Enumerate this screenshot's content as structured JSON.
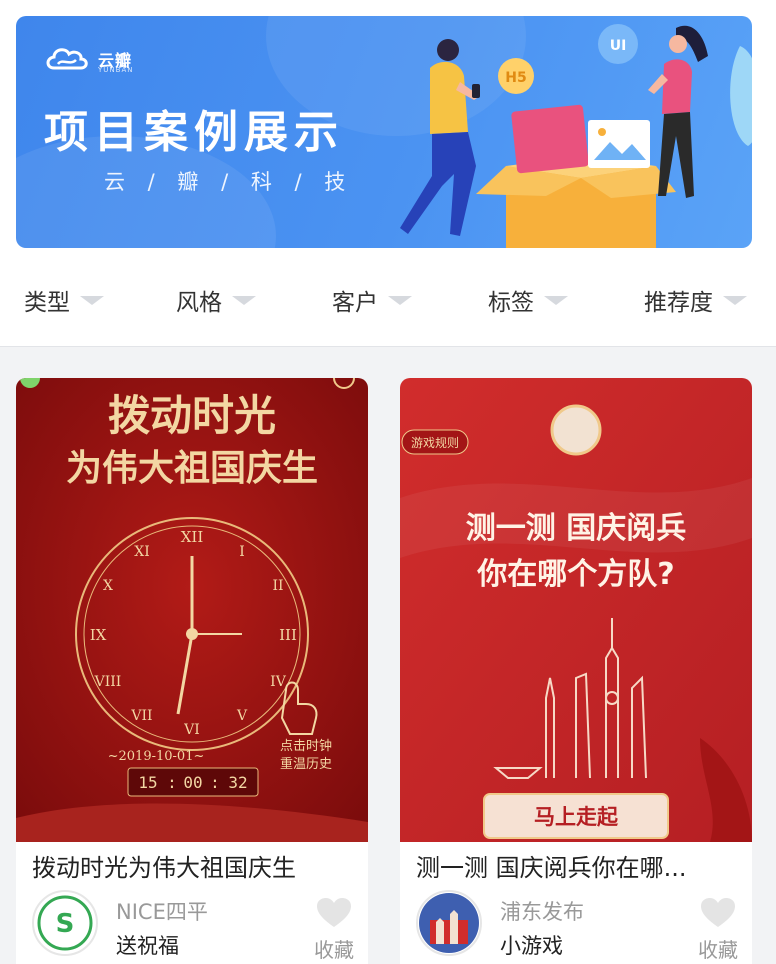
{
  "banner": {
    "brand_name": "云瓣",
    "brand_sub": "YUNBAN",
    "title": "项目案例展示",
    "subtitle": "云 / 瓣 / 科 / 技",
    "badge_h5": "H5",
    "badge_ui": "UI"
  },
  "filters": [
    {
      "label": "类型"
    },
    {
      "label": "风格"
    },
    {
      "label": "客户"
    },
    {
      "label": "标签"
    },
    {
      "label": "推荐度"
    }
  ],
  "cards": [
    {
      "poster": {
        "title_line1": "拨动时光",
        "title_line2": "为伟大祖国庆生",
        "date": "~2019-10-01~",
        "time_h": "15",
        "time_m": "00",
        "time_s": "32",
        "hint_line1": "点击时钟",
        "hint_line2": "重温历史"
      },
      "title": "拨动时光为伟大祖国庆生",
      "author": "NICE四平",
      "category": "送祝福",
      "fav_label": "收藏"
    },
    {
      "poster": {
        "rules_tag": "游戏规则",
        "title_line1": "测一测 国庆阅兵",
        "title_line2": "你在哪个方队?",
        "cta": "马上走起"
      },
      "title": "测一测 国庆阅兵你在哪...",
      "author": "浦东发布",
      "category": "小游戏",
      "fav_label": "收藏"
    }
  ],
  "colors": {
    "banner_blue": "#4b93f2",
    "poster_red": "#9e1212",
    "poster_red2": "#c8262a",
    "gold": "#f0c98a"
  }
}
